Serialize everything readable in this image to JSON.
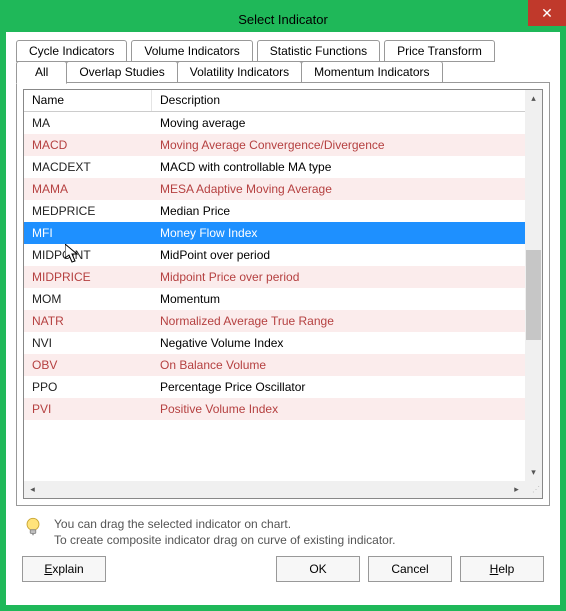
{
  "window": {
    "title": "Select Indicator"
  },
  "tabs_upper": [
    {
      "label": "Cycle Indicators"
    },
    {
      "label": "Volume Indicators"
    },
    {
      "label": "Statistic Functions"
    },
    {
      "label": "Price Transform"
    }
  ],
  "tabs_lower": [
    {
      "label": "All",
      "active": true
    },
    {
      "label": "Overlap Studies"
    },
    {
      "label": "Volatility Indicators"
    },
    {
      "label": "Momentum Indicators"
    }
  ],
  "columns": {
    "name": "Name",
    "description": "Description"
  },
  "rows": [
    {
      "name": "MA",
      "desc": "Moving average",
      "style": "plain"
    },
    {
      "name": "MACD",
      "desc": "Moving Average Convergence/Divergence",
      "style": "pink"
    },
    {
      "name": "MACDEXT",
      "desc": "MACD with controllable MA type",
      "style": "plain"
    },
    {
      "name": "MAMA",
      "desc": "MESA Adaptive Moving Average",
      "style": "pink"
    },
    {
      "name": "MEDPRICE",
      "desc": "Median Price",
      "style": "plain"
    },
    {
      "name": "MFI",
      "desc": "Money Flow Index",
      "style": "sel"
    },
    {
      "name": "MIDPOINT",
      "desc": "MidPoint over period",
      "style": "plain"
    },
    {
      "name": "MIDPRICE",
      "desc": "Midpoint Price over period",
      "style": "pink"
    },
    {
      "name": "MOM",
      "desc": "Momentum",
      "style": "plain"
    },
    {
      "name": "NATR",
      "desc": "Normalized Average True Range",
      "style": "pink"
    },
    {
      "name": "NVI",
      "desc": "Negative Volume Index",
      "style": "plain"
    },
    {
      "name": "OBV",
      "desc": "On Balance Volume",
      "style": "pink"
    },
    {
      "name": "PPO",
      "desc": "Percentage Price Oscillator",
      "style": "plain"
    },
    {
      "name": "PVI",
      "desc": "Positive Volume Index",
      "style": "pink"
    }
  ],
  "hint": {
    "line1": "You can drag the selected indicator on chart.",
    "line2": "To create composite indicator drag on curve of existing indicator."
  },
  "buttons": {
    "explain": "xplain",
    "explain_m": "E",
    "ok": "OK",
    "cancel": "Cancel",
    "help": "elp",
    "help_m": "H"
  }
}
